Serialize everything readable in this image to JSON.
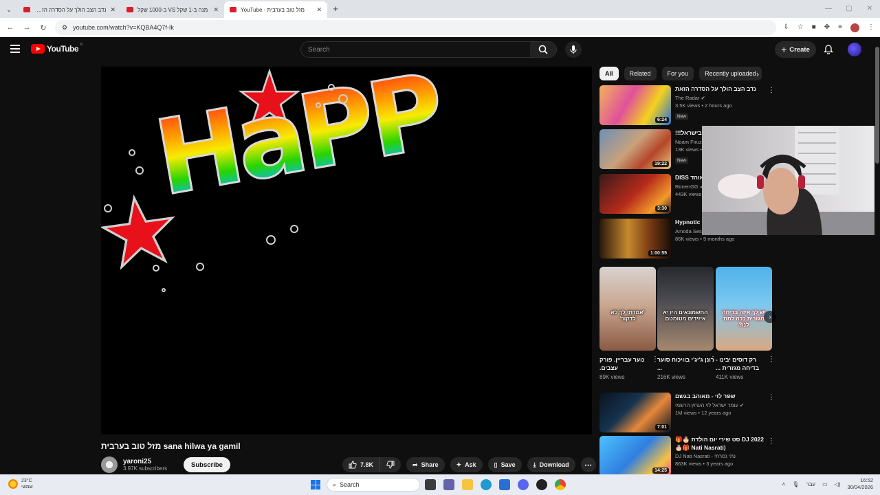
{
  "browser": {
    "tabs": [
      {
        "title": "נדב הצב הולך על הסדרה הזאת!",
        "active": false
      },
      {
        "title": "מנה ב-1 שקל VS ב-1000 שקל",
        "active": false
      },
      {
        "title": "מזל טוב בערבית - YouTube",
        "active": true
      }
    ],
    "url": "youtube.com/watch?v=KQBA4Q7f-Ik"
  },
  "youtube": {
    "logo_text": "YouTube",
    "country_code": "IL",
    "search_placeholder": "Search",
    "create_label": "Create"
  },
  "video": {
    "art_text": "HaPP",
    "title": "מזל טוב בערבית sana hilwa ya gamil",
    "channel": "yaroni25",
    "subscribers": "3.97K subscribers",
    "subscribe_label": "Subscribe",
    "likes": "7.8K",
    "actions": {
      "share": "Share",
      "ask": "Ask",
      "save": "Save",
      "download": "Download"
    }
  },
  "chips": [
    "All",
    "Related",
    "For you",
    "Recently uploaded"
  ],
  "recommendations": [
    {
      "title": "נדב הצב הולך על הסדרה הזאת",
      "channel": "The Radar",
      "verified": true,
      "meta": "3.5K views • 2 hours ago",
      "badge": "New",
      "duration": "6:24"
    },
    {
      "title": "10 שקל בכל... בישראל!!!",
      "channel": "Noam Firuz",
      "verified": false,
      "meta": "13K views • ...",
      "badge": "New",
      "duration": "19:22"
    },
    {
      "title": "כהן & אוהד DISS",
      "channel": "RonenGG",
      "verified": true,
      "meta": "443K views • ...",
      "badge": "",
      "duration": "3:30"
    },
    {
      "title": "Hypnotic D... Rise of the...",
      "channel": "Amoda Session",
      "verified": false,
      "meta": "86K views • 5 months ago",
      "badge": "",
      "duration": "1:00:55"
    }
  ],
  "shorts": [
    {
      "title": "נוער עבריין. פורק עצבים.",
      "views": "89K views",
      "caption": "'אמרתי לך לא לדקור'"
    },
    {
      "title": "רונן ג'יג'י בוויכוח סוער ...",
      "views": "216K views",
      "caption": "החשמונאים היו יא איזידים מטומטם"
    },
    {
      "title": "רק דוסים יבינו - בדיחה מגזרית ...",
      "views": "411K views",
      "caption": "יש לך איזה בדיחה מגזרית ככה לתת לנו?"
    }
  ],
  "more_recommendations": [
    {
      "title": "שפר לוי - מאוהב בגשם",
      "channel": "עומר ישראל לוי הערוץ הרשמי",
      "verified": true,
      "meta": "1M views • 12 years ago",
      "duration": "7:01"
    },
    {
      "title": "DJ 2022 סט שירי יום הולדת 🎂🎁 (Nati Nasrati 🎁🎂",
      "channel": "DJ Nati Nasrati - נתי נסרתי",
      "verified": false,
      "meta": "863K views • 3 years ago",
      "duration": "14:25"
    }
  ],
  "taskbar": {
    "weather_temp": "23°C",
    "weather_desc": "שמשי",
    "search_label": "Search",
    "lang": "עבר",
    "time": "16:52",
    "date": "30/04/2026"
  },
  "colors": {
    "yt_bg": "#0f0f0f",
    "yt_red": "#ff0000",
    "chip_bg": "#272727",
    "taskbar_bg": "#e8ecf2"
  }
}
